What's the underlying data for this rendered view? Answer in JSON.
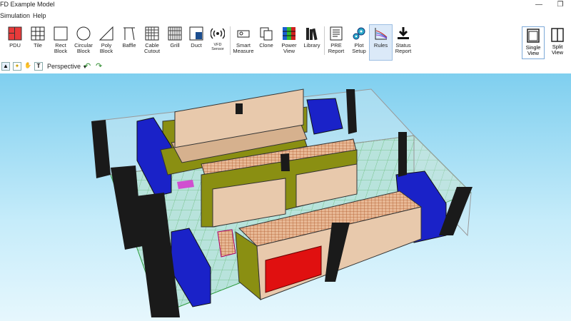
{
  "window": {
    "title": "FD Example Model",
    "restore_icon": "restore-icon",
    "minimize_icon": "minimize-icon"
  },
  "menu": [
    "Simulation",
    "Help"
  ],
  "toolbar": {
    "tools": [
      {
        "id": "pdu",
        "label": "PDU"
      },
      {
        "id": "tile",
        "label": "Tile"
      },
      {
        "id": "rect-block",
        "label": "Rect\nBlock"
      },
      {
        "id": "circular-block",
        "label": "Circular\nBlock"
      },
      {
        "id": "poly-block",
        "label": "Poly\nBlock"
      },
      {
        "id": "baffle",
        "label": "Baffle"
      },
      {
        "id": "cable-cutout",
        "label": "Cable\nCutout"
      },
      {
        "id": "grill",
        "label": "Grill"
      },
      {
        "id": "duct",
        "label": "Duct"
      },
      {
        "id": "vfd-sensor",
        "label": "VFD\nSensor"
      },
      {
        "id": "smart-measure",
        "label": "Smart\nMeasure"
      },
      {
        "id": "clone",
        "label": "Clone"
      },
      {
        "id": "power-view",
        "label": "Power\nView"
      },
      {
        "id": "library",
        "label": "Library"
      },
      {
        "id": "pre-report",
        "label": "PRE\nReport"
      },
      {
        "id": "plot-setup",
        "label": "Plot\nSetup"
      },
      {
        "id": "rules",
        "label": "Rules"
      },
      {
        "id": "status-report",
        "label": "Status\nReport"
      }
    ],
    "view_buttons": [
      {
        "id": "single-view",
        "label": "Single\nView"
      },
      {
        "id": "split-view",
        "label": "Split\nView"
      }
    ]
  },
  "view_toolbar": {
    "projection": "Perspective",
    "text_tool": "T"
  },
  "colors": {
    "rack_face": "#e8c9ac",
    "rack_side": "#8a8f12",
    "crac": "#1a22c8",
    "red_unit": "#e01010",
    "pillar": "#1a1a1a",
    "floor_grid": "#aaddd6",
    "perforated_tile": "#d0703c"
  }
}
